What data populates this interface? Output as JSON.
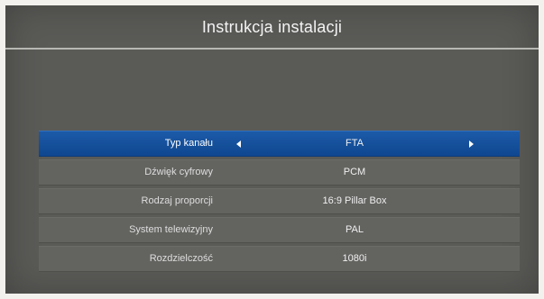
{
  "header": {
    "title": "Instrukcja instalacji"
  },
  "settings": {
    "rows": [
      {
        "label": "Typ kanału",
        "value": "FTA"
      },
      {
        "label": "Dźwięk cyfrowy",
        "value": "PCM"
      },
      {
        "label": "Rodzaj proporcji",
        "value": "16:9 Pillar Box"
      },
      {
        "label": "System telewizyjny",
        "value": "PAL"
      },
      {
        "label": "Rozdzielczość",
        "value": "1080i"
      }
    ],
    "selected_index": 0,
    "icons": {
      "prev": "triangle-left-icon",
      "next": "triangle-right-icon"
    }
  },
  "colors": {
    "background": "#5a5a57",
    "selection": "#1553a0",
    "text": "#f0f0f0"
  }
}
